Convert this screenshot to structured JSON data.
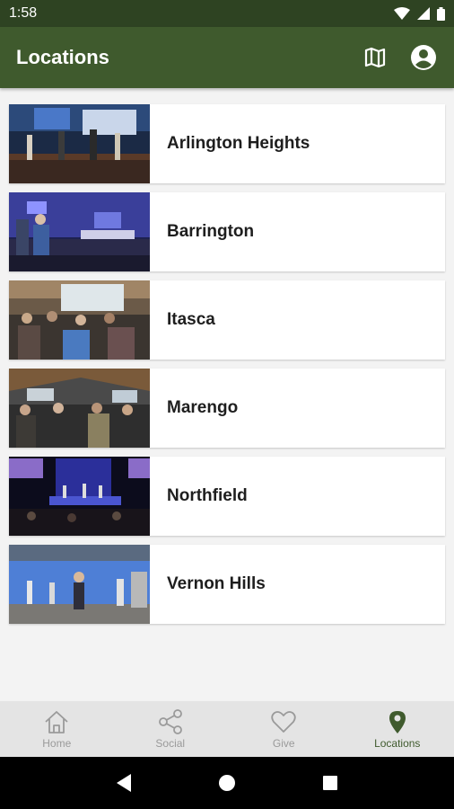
{
  "status_bar": {
    "time": "1:58"
  },
  "header": {
    "title": "Locations"
  },
  "locations": [
    {
      "name": "Arlington Heights"
    },
    {
      "name": "Barrington"
    },
    {
      "name": "Itasca"
    },
    {
      "name": "Marengo"
    },
    {
      "name": "Northfield"
    },
    {
      "name": "Vernon Hills"
    }
  ],
  "bottom_nav": {
    "items": [
      {
        "label": "Home",
        "icon": "home-icon"
      },
      {
        "label": "Social",
        "icon": "share-icon"
      },
      {
        "label": "Give",
        "icon": "heart-icon"
      },
      {
        "label": "Locations",
        "icon": "map-pin-icon"
      }
    ],
    "active": "Locations"
  },
  "colors": {
    "primary": "#3f5a2d",
    "status_bar": "#2e4322",
    "background": "#f3f3f3"
  }
}
